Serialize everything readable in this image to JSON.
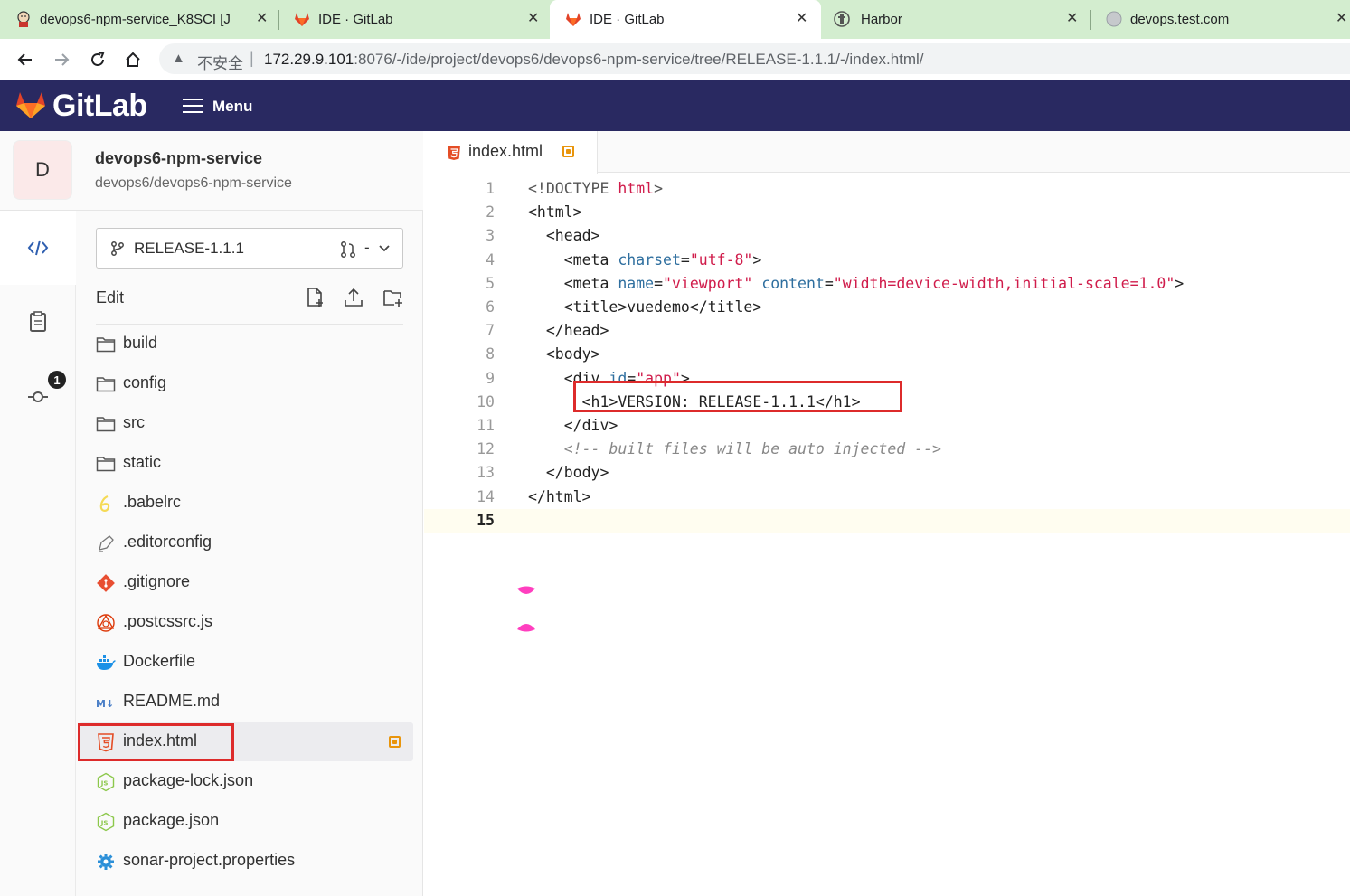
{
  "browser": {
    "tabs": [
      {
        "title": "devops6-npm-service_K8SCI [J",
        "icon": "jenkins-icon",
        "active": false
      },
      {
        "title": "IDE · GitLab",
        "icon": "gitlab-icon",
        "active": false
      },
      {
        "title": "IDE · GitLab",
        "icon": "gitlab-icon",
        "active": true
      },
      {
        "title": "Harbor",
        "icon": "harbor-icon",
        "active": false
      },
      {
        "title": "devops.test.com",
        "icon": "globe-icon",
        "active": false
      }
    ],
    "close_glyph": "✕",
    "security_label": "不安全",
    "url_host": "172.29.9.101",
    "url_rest": ":8076/-/ide/project/devops6/devops6-npm-service/tree/RELEASE-1.1.1/-/index.html/"
  },
  "header": {
    "brand": "GitLab",
    "menu_label": "Menu"
  },
  "project": {
    "avatar_letter": "D",
    "name": "devops6-npm-service",
    "path": "devops6/devops6-npm-service"
  },
  "rail": {
    "commit_badge": "1"
  },
  "tree": {
    "branch": "RELEASE-1.1.1",
    "branch_mr_dash": "-",
    "edit_label": "Edit",
    "files": [
      {
        "name": "build",
        "icon": "folder-icon"
      },
      {
        "name": "config",
        "icon": "folder-icon"
      },
      {
        "name": "src",
        "icon": "folder-icon"
      },
      {
        "name": "static",
        "icon": "folder-icon"
      },
      {
        "name": ".babelrc",
        "icon": "babel-icon"
      },
      {
        "name": ".editorconfig",
        "icon": "editorconfig-icon"
      },
      {
        "name": ".gitignore",
        "icon": "git-icon"
      },
      {
        "name": ".postcssrc.js",
        "icon": "postcss-icon"
      },
      {
        "name": "Dockerfile",
        "icon": "docker-icon"
      },
      {
        "name": "README.md",
        "icon": "markdown-icon"
      },
      {
        "name": "index.html",
        "icon": "html5-icon",
        "active": true,
        "modified": true
      },
      {
        "name": "package-lock.json",
        "icon": "nodejs-icon"
      },
      {
        "name": "package.json",
        "icon": "nodejs-icon"
      },
      {
        "name": "sonar-project.properties",
        "icon": "gear-icon"
      }
    ]
  },
  "editor": {
    "tab_name": "index.html",
    "current_line": 15,
    "lines": [
      {
        "n": "1",
        "tokens": [
          [
            "doctype",
            "<!DOCTYPE "
          ],
          [
            "str",
            "html"
          ],
          [
            "doctype",
            ">"
          ]
        ]
      },
      {
        "n": "2",
        "tokens": [
          [
            "tag",
            "<html>"
          ]
        ]
      },
      {
        "n": "3",
        "tokens": [
          [
            "tag",
            "  <head>"
          ]
        ]
      },
      {
        "n": "4",
        "tokens": [
          [
            "tag",
            "    <meta "
          ],
          [
            "attr",
            "charset"
          ],
          [
            "tag",
            "="
          ],
          [
            "str",
            "\"utf-8\""
          ],
          [
            "tag",
            ">"
          ]
        ]
      },
      {
        "n": "5",
        "tokens": [
          [
            "tag",
            "    <meta "
          ],
          [
            "attr",
            "name"
          ],
          [
            "tag",
            "="
          ],
          [
            "str",
            "\"viewport\""
          ],
          [
            "tag",
            " "
          ],
          [
            "attr",
            "content"
          ],
          [
            "tag",
            "="
          ],
          [
            "str",
            "\"width=device-width,initial-scale=1.0\""
          ],
          [
            "tag",
            ">"
          ]
        ]
      },
      {
        "n": "6",
        "tokens": [
          [
            "tag",
            "    <title>vuedemo</title>"
          ]
        ]
      },
      {
        "n": "7",
        "tokens": [
          [
            "tag",
            "  </head>"
          ]
        ]
      },
      {
        "n": "8",
        "tokens": [
          [
            "tag",
            "  <body>"
          ]
        ]
      },
      {
        "n": "9",
        "tokens": [
          [
            "tag",
            "    <div "
          ],
          [
            "attr",
            "id"
          ],
          [
            "tag",
            "="
          ],
          [
            "str",
            "\"app\""
          ],
          [
            "tag",
            ">"
          ]
        ]
      },
      {
        "n": "10",
        "tokens": [
          [
            "tag",
            "      <h1>VERSION: RELEASE-1.1.1</h1>"
          ]
        ]
      },
      {
        "n": "11",
        "tokens": [
          [
            "tag",
            "    </div>"
          ]
        ]
      },
      {
        "n": "12",
        "tokens": [
          [
            "comment",
            "    <!-- built files will be auto injected -->"
          ]
        ]
      },
      {
        "n": "13",
        "tokens": [
          [
            "tag",
            "  </body>"
          ]
        ]
      },
      {
        "n": "14",
        "tokens": [
          [
            "tag",
            "</html>"
          ]
        ]
      },
      {
        "n": "15",
        "tokens": []
      }
    ]
  },
  "colors": {
    "gitlab_header": "#292961",
    "gitlab_orange": "#e24329",
    "modified_indicator": "#e9950c",
    "highlight_box": "#dd2b2b",
    "string_token": "#d01c4b",
    "attr_token": "#2f6f9f",
    "browser_tabstrip": "#d3edcf"
  }
}
